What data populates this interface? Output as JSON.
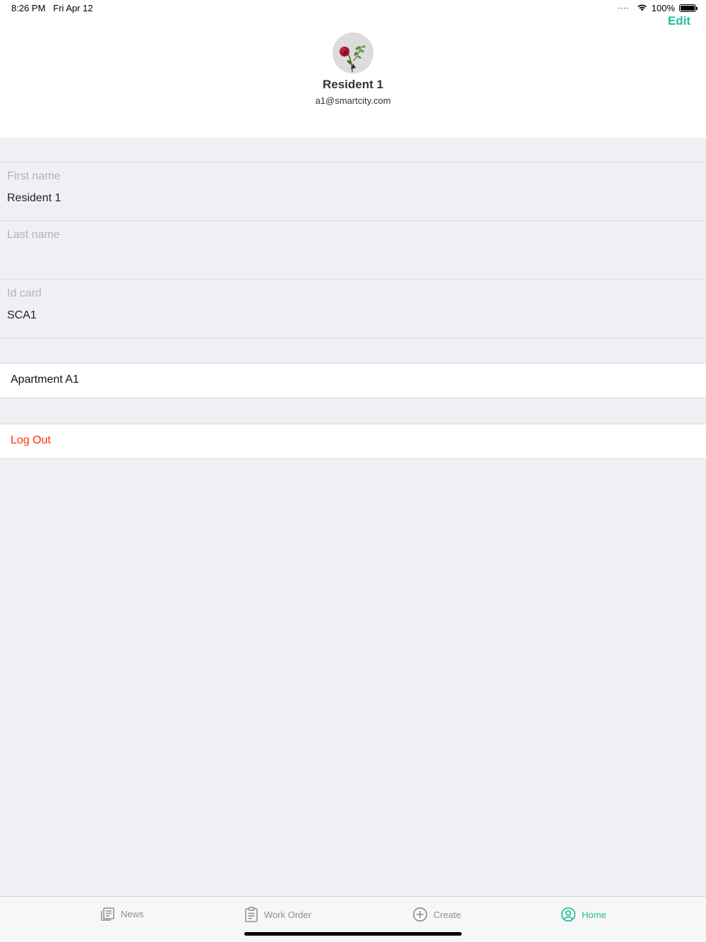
{
  "status_bar": {
    "time": "8:26 PM",
    "date": "Fri Apr 12",
    "battery": "100%",
    "icons": [
      "signal-icon",
      "wifi-icon",
      "battery-icon"
    ]
  },
  "header": {
    "edit_label": "Edit",
    "name": "Resident 1",
    "email": "a1@smartcity.com",
    "accent_color": "#1fbf9c"
  },
  "fields": {
    "first_name": {
      "label": "First name",
      "value": "Resident 1"
    },
    "last_name": {
      "label": "Last name",
      "value": ""
    },
    "id_card": {
      "label": "Id card",
      "value": "SCA1"
    }
  },
  "rows": {
    "apartment": "Apartment A1",
    "logout": "Log Out",
    "logout_color": "#ff2d10"
  },
  "tab_bar": {
    "tabs": [
      {
        "label": "News",
        "icon": "news-icon",
        "active": false
      },
      {
        "label": "Work Order",
        "icon": "clipboard-icon",
        "active": false
      },
      {
        "label": "Create",
        "icon": "plus-circle-icon",
        "active": false
      },
      {
        "label": "Home",
        "icon": "user-circle-icon",
        "active": true
      }
    ]
  }
}
